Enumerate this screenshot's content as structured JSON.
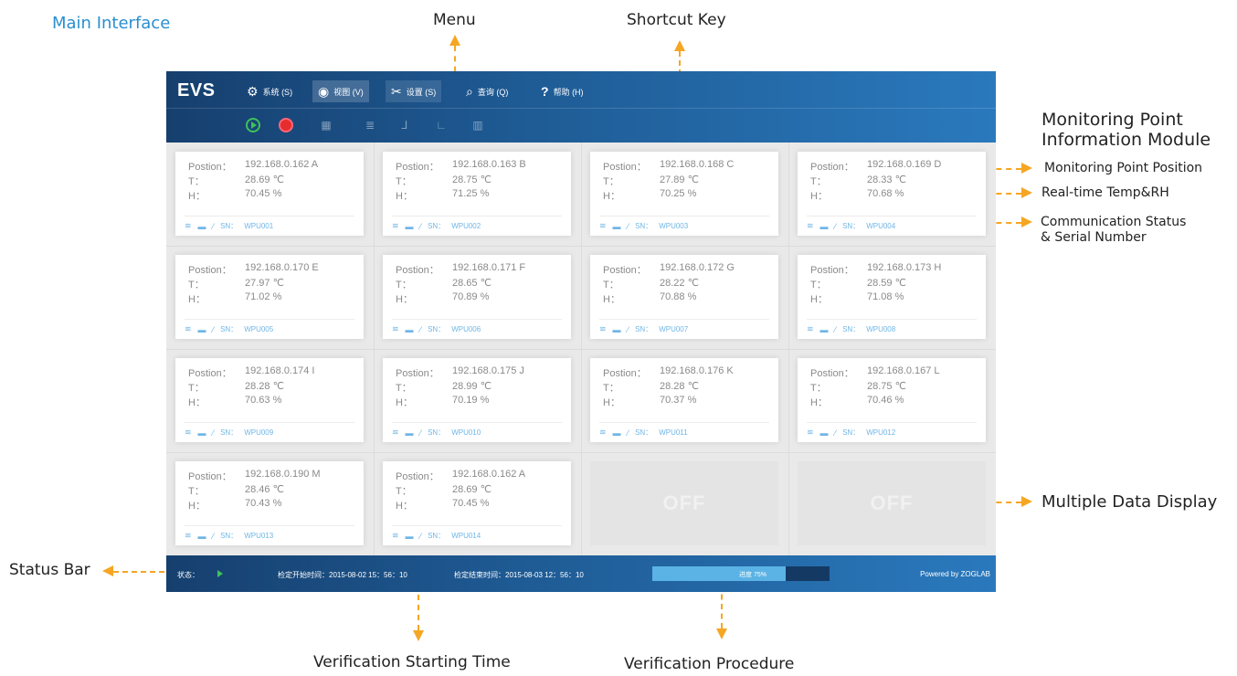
{
  "annotations": {
    "main_interface": "Main Interface",
    "menu": "Menu",
    "shortcut_key": "Shortcut Key",
    "monitoring_module_line1": "Monitoring Point",
    "monitoring_module_line2": "Information Module",
    "monitoring_point_position": "Monitoring Point Position",
    "realtime_temp_rh": "Real-time Temp&RH",
    "comm_status_line1": "Communication Status",
    "comm_status_line2": "& Serial Number",
    "multiple_data_display": "Multiple Data Display",
    "status_bar": "Status Bar",
    "verification_starting_time": "Verification Starting Time",
    "verification_procedure": "Verification Procedure"
  },
  "app": {
    "logo": "EVS",
    "menu": [
      {
        "icon": "gear-icon",
        "label": "系统 (S)"
      },
      {
        "icon": "eye-icon",
        "label": "视图 (V)"
      },
      {
        "icon": "tools-icon",
        "label": "设置 (S)"
      },
      {
        "icon": "search-icon",
        "label": "查询 (Q)"
      },
      {
        "icon": "help-icon",
        "label": "帮助 (H)"
      }
    ],
    "toolbar": [
      "play-icon",
      "stop-icon",
      "grid-icon",
      "list-icon",
      "chart-icon",
      "axis-icon",
      "bars-icon"
    ],
    "labels": {
      "position": "Postion：",
      "t": "T：",
      "h": "H：",
      "sn": "SN："
    },
    "cards": [
      {
        "position": "192.168.0.162 A",
        "t": "28.69 ℃",
        "h": "70.45 %",
        "sn": "WPU001"
      },
      {
        "position": "192.168.0.163 B",
        "t": "28.75 ℃",
        "h": "71.25 %",
        "sn": "WPU002"
      },
      {
        "position": "192.168.0.168 C",
        "t": "27.89 ℃",
        "h": "70.25 %",
        "sn": "WPU003"
      },
      {
        "position": "192.168.0.169 D",
        "t": "28.33 ℃",
        "h": "70.68 %",
        "sn": "WPU004"
      },
      {
        "position": "192.168.0.170 E",
        "t": "27.97 ℃",
        "h": "71.02 %",
        "sn": "WPU005"
      },
      {
        "position": "192.168.0.171 F",
        "t": "28.65 ℃",
        "h": "70.89 %",
        "sn": "WPU006"
      },
      {
        "position": "192.168.0.172 G",
        "t": "28.22 ℃",
        "h": "70.88 %",
        "sn": "WPU007"
      },
      {
        "position": "192.168.0.173 H",
        "t": "28.59 ℃",
        "h": "71.08 %",
        "sn": "WPU008"
      },
      {
        "position": "192.168.0.174 I",
        "t": "28.28 ℃",
        "h": "70.63 %",
        "sn": "WPU009"
      },
      {
        "position": "192.168.0.175 J",
        "t": "28.99 ℃",
        "h": "70.19 %",
        "sn": "WPU010"
      },
      {
        "position": "192.168.0.176 K",
        "t": "28.28 ℃",
        "h": "70.37 %",
        "sn": "WPU011"
      },
      {
        "position": "192.168.0.167 L",
        "t": "28.75 ℃",
        "h": "70.46 %",
        "sn": "WPU012"
      },
      {
        "position": "192.168.0.190 M",
        "t": "28.46 ℃",
        "h": "70.43 %",
        "sn": "WPU013"
      },
      {
        "position": "192.168.0.162 A",
        "t": "28.69 ℃",
        "h": "70.45 %",
        "sn": "WPU014"
      }
    ],
    "off_label": "OFF",
    "status": {
      "label": "状态：",
      "start_time": "检定开始时间：2015-08-02  15：56：10",
      "end_time": "检定结束时间：2015-08-03  12：56：10",
      "progress_text": "进度  75%",
      "progress_value": 0.75,
      "powered_by": "Powered by ZOGLAB"
    }
  }
}
